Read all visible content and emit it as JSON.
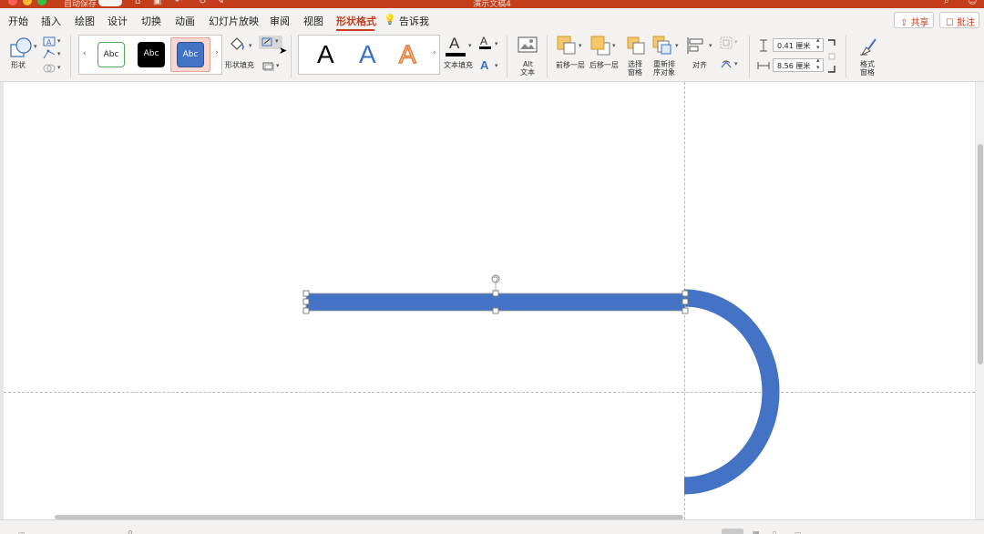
{
  "window": {
    "title": "演示文稿4",
    "autosave_label": "自动保存",
    "autosave_state": "关闭"
  },
  "tabs": [
    {
      "label": "开始",
      "active": false
    },
    {
      "label": "插入",
      "active": false
    },
    {
      "label": "绘图",
      "active": false
    },
    {
      "label": "设计",
      "active": false
    },
    {
      "label": "切换",
      "active": false
    },
    {
      "label": "动画",
      "active": false
    },
    {
      "label": "幻灯片放映",
      "active": false
    },
    {
      "label": "审阅",
      "active": false
    },
    {
      "label": "视图",
      "active": false
    },
    {
      "label": "形状格式",
      "active": true
    }
  ],
  "tell_me": "告诉我",
  "share_label": "共享",
  "comment_label": "批注",
  "ribbon": {
    "shapes_label": "形状",
    "style_samples": [
      "Abc",
      "Abc",
      "Abc"
    ],
    "shape_fill_label": "形状填充",
    "wordart_samples": [
      "A",
      "A",
      "A"
    ],
    "text_fill_label": "文本填充",
    "alt_text_line1": "Alt",
    "alt_text_line2": "文本",
    "bring_forward_label": "前移一层",
    "send_backward_label": "后移一层",
    "selection_pane_line1": "选择",
    "selection_pane_line2": "窗格",
    "reorder_line1": "重新排",
    "reorder_line2": "序对象",
    "align_label": "对齐",
    "height_value": "0.41 厘米",
    "width_value": "8.56 厘米",
    "format_pane_line1": "格式",
    "format_pane_line2": "窗格"
  },
  "colors": {
    "accent": "#c43e1c",
    "shape_blue": "#4472c4",
    "ribbon_bg": "#f3f2f1"
  },
  "icons": [
    "shapes-icon",
    "edit-shape-icon",
    "text-box-icon",
    "paint-bucket-icon",
    "outline-pen-icon",
    "effects-icon",
    "alt-text-image-icon",
    "bring-forward-icon",
    "send-backward-icon",
    "selection-pane-icon",
    "reorder-icon",
    "align-icon",
    "group-icon",
    "rotate-icon",
    "height-icon",
    "width-icon",
    "format-pane-icon",
    "rotate-handle-icon"
  ]
}
